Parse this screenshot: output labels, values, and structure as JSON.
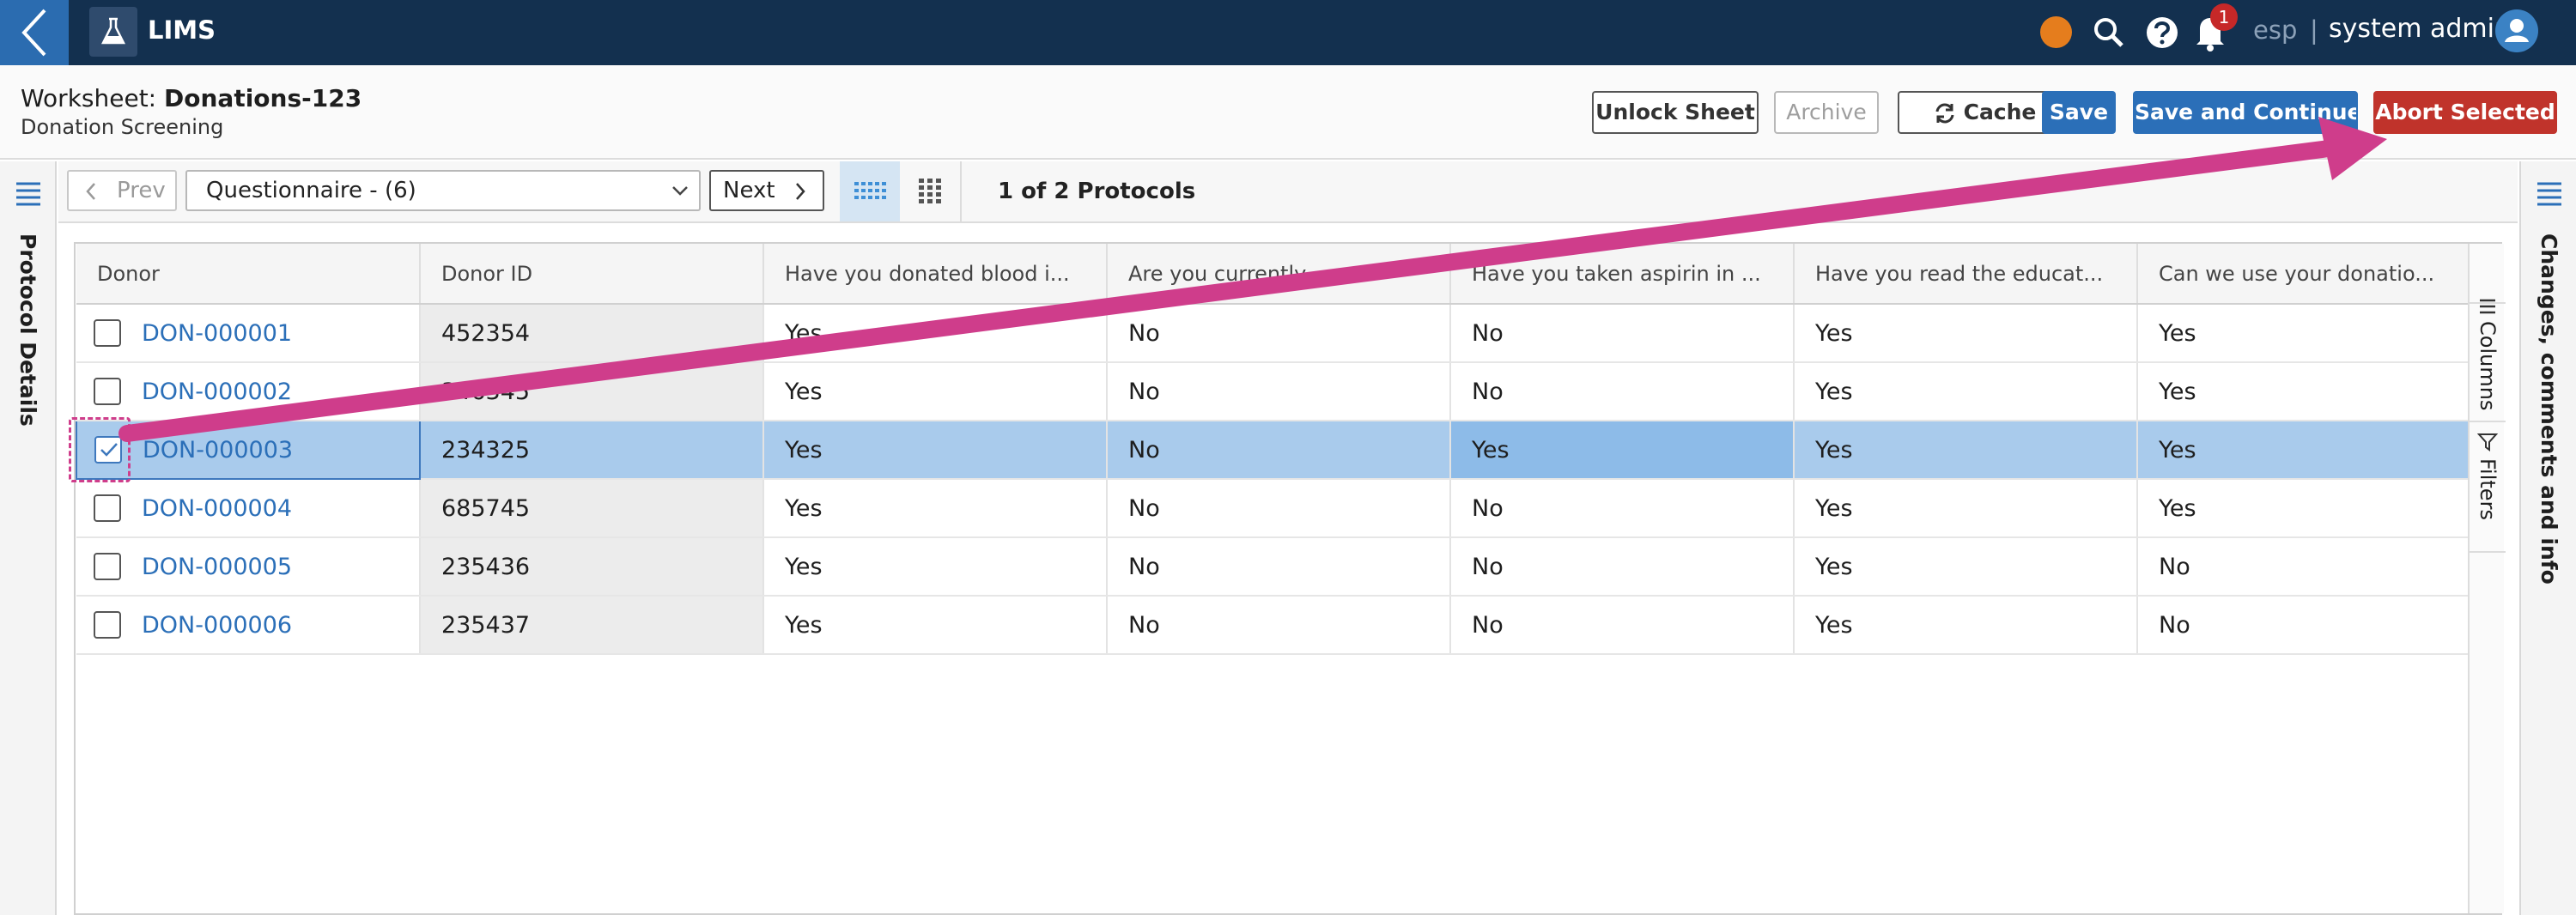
{
  "app": {
    "title": "LIMS",
    "language": "esp",
    "separator": "|",
    "user": "system admin",
    "notification_count": "1"
  },
  "icons": {
    "back": "chevron-left-icon",
    "logo": "flask-icon",
    "status": "status-dot-icon",
    "search": "search-icon",
    "help": "help-icon",
    "bell": "bell-icon",
    "avatar": "user-icon",
    "cache": "refresh-icon",
    "list": "list-icon",
    "dropdown": "chevron-down-icon",
    "view_dense": "dense-grid-icon",
    "view_grid": "grid-icon",
    "columns": "columns-icon",
    "filter": "filter-icon",
    "checkbox": "checkbox-icon",
    "check": "checkmark-icon"
  },
  "colors": {
    "topbar": "#13304f",
    "accent": "#2b6fb8",
    "danger": "#c0332b",
    "selection": "#a9cbec",
    "annotation": "#cf3d8b"
  },
  "header": {
    "worksheet_label": "Worksheet:",
    "worksheet_name": "Donations-123",
    "subtitle": "Donation Screening",
    "buttons": {
      "unlock": "Unlock Sheet",
      "archive": "Archive",
      "cache": "Cache",
      "save": "Save",
      "save_continue": "Save and Continue",
      "abort": "Abort Selected"
    }
  },
  "panels": {
    "left": "Protocol Details",
    "right": "Changes, comments and info"
  },
  "toolbar": {
    "prev": "Prev",
    "protocol_select": "Questionnaire - (6)",
    "next": "Next",
    "protocol_count": "1 of 2 Protocols"
  },
  "grid": {
    "columns": [
      "Donor",
      "Donor ID",
      "Have you donated blood i...",
      "Are you currently ... ",
      "Have you taken aspirin in ...",
      "Have you read the educat...",
      "Can we use your donatio..."
    ],
    "rows": [
      {
        "donor": "DON-000001",
        "donor_id": "452354",
        "q1": "Yes",
        "q2": "No",
        "q3": "No",
        "q4": "Yes",
        "q5": "Yes",
        "checked": false
      },
      {
        "donor": "DON-000002",
        "donor_id": "346345",
        "q1": "Yes",
        "q2": "No",
        "q3": "No",
        "q4": "Yes",
        "q5": "Yes",
        "checked": false
      },
      {
        "donor": "DON-000003",
        "donor_id": "234325",
        "q1": "Yes",
        "q2": "No",
        "q3": "Yes",
        "q4": "Yes",
        "q5": "Yes",
        "checked": true
      },
      {
        "donor": "DON-000004",
        "donor_id": "685745",
        "q1": "Yes",
        "q2": "No",
        "q3": "No",
        "q4": "Yes",
        "q5": "Yes",
        "checked": false
      },
      {
        "donor": "DON-000005",
        "donor_id": "235436",
        "q1": "Yes",
        "q2": "No",
        "q3": "No",
        "q4": "Yes",
        "q5": "No",
        "checked": false
      },
      {
        "donor": "DON-000006",
        "donor_id": "235437",
        "q1": "Yes",
        "q2": "No",
        "q3": "No",
        "q4": "Yes",
        "q5": "No",
        "checked": false
      }
    ],
    "side_tabs": {
      "columns": "Columns",
      "filters": "Filters"
    }
  }
}
